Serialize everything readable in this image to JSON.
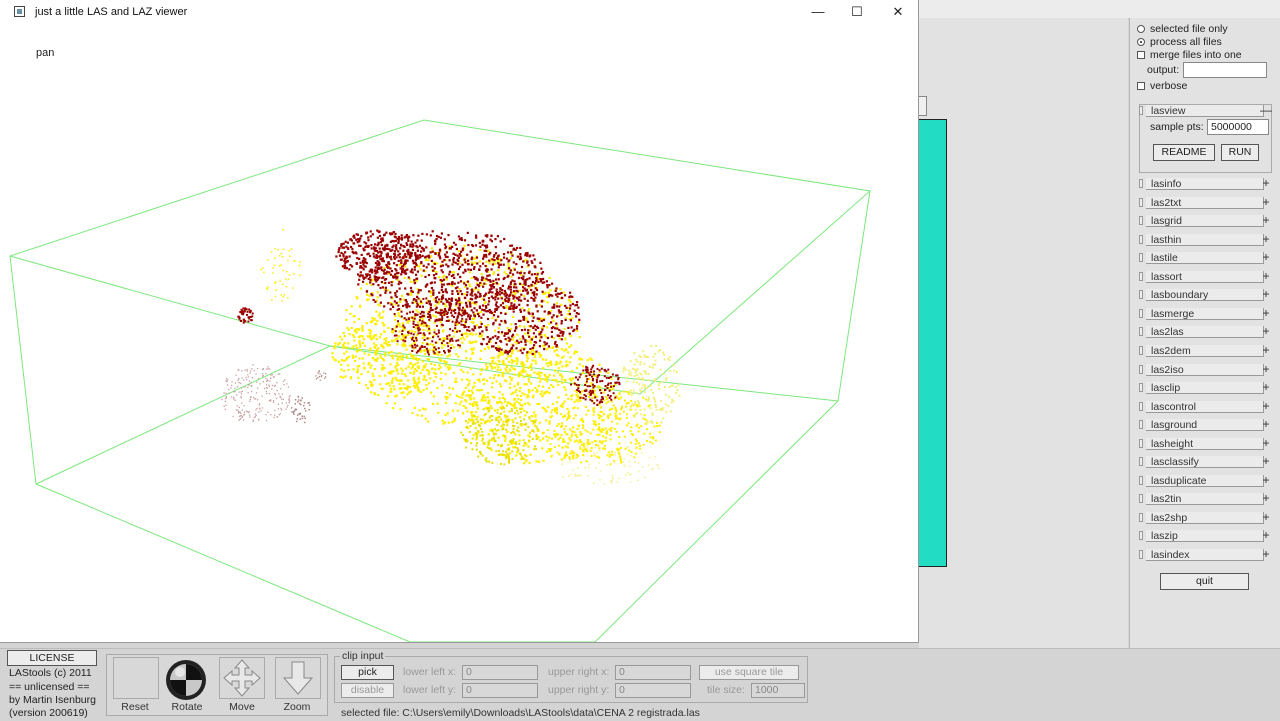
{
  "viewer": {
    "title": "just a little LAS and LAZ viewer",
    "mode_label": "pan",
    "controls": {
      "minimize": "—",
      "maximize": "☐",
      "close": "✕"
    }
  },
  "options": {
    "selected_file_only": "selected file only",
    "process_all_files": "process all files",
    "merge_files": "merge files into one",
    "output_label": "output:",
    "output_value": "",
    "verbose": "verbose"
  },
  "lasview": {
    "title": "lasview",
    "collapse_glyph": "—",
    "sample_label": "sample pts:",
    "sample_value": "5000000",
    "readme": "README",
    "run": "RUN"
  },
  "tools": [
    "lasinfo",
    "las2txt",
    "lasgrid",
    "lasthin",
    "lastile",
    "lassort",
    "lasboundary",
    "lasmerge",
    "las2las",
    "las2dem",
    "las2iso",
    "lasclip",
    "lascontrol",
    "lasground",
    "lasheight",
    "lasclassify",
    "lasduplicate",
    "las2tin",
    "las2shp",
    "laszip",
    "lasindex"
  ],
  "tool_expand_glyph": "+",
  "quit": "quit",
  "license": {
    "button": "LICENSE",
    "lines": [
      "LAStools (c) 2011",
      "== unlicensed ==",
      "by Martin Isenburg",
      "(version 200619)"
    ]
  },
  "nav": {
    "reset": "Reset",
    "rotate": "Rotate",
    "move": "Move",
    "zoom": "Zoom"
  },
  "clip": {
    "title": "clip input",
    "pick": "pick",
    "disable": "disable",
    "lower_left_x_label": "lower left x:",
    "lower_left_x": "0",
    "lower_left_y_label": "lower left y:",
    "lower_left_y": "0",
    "upper_right_x_label": "upper right x:",
    "upper_right_x": "0",
    "upper_right_y_label": "upper right y:",
    "upper_right_y": "0",
    "use_square_tile": "use square tile",
    "tile_size_label": "tile size:",
    "tile_size": "1000"
  },
  "selected_file": "selected file: C:\\Users\\emily\\Downloads\\LAStools\\data\\CENA 2 registrada.las",
  "colors": {
    "teal": "#22dcc4",
    "bbox_green": "#7de77d",
    "points_red": "#9a0000",
    "points_yellow": "#ffee00",
    "window_bg": "#ffffff"
  }
}
